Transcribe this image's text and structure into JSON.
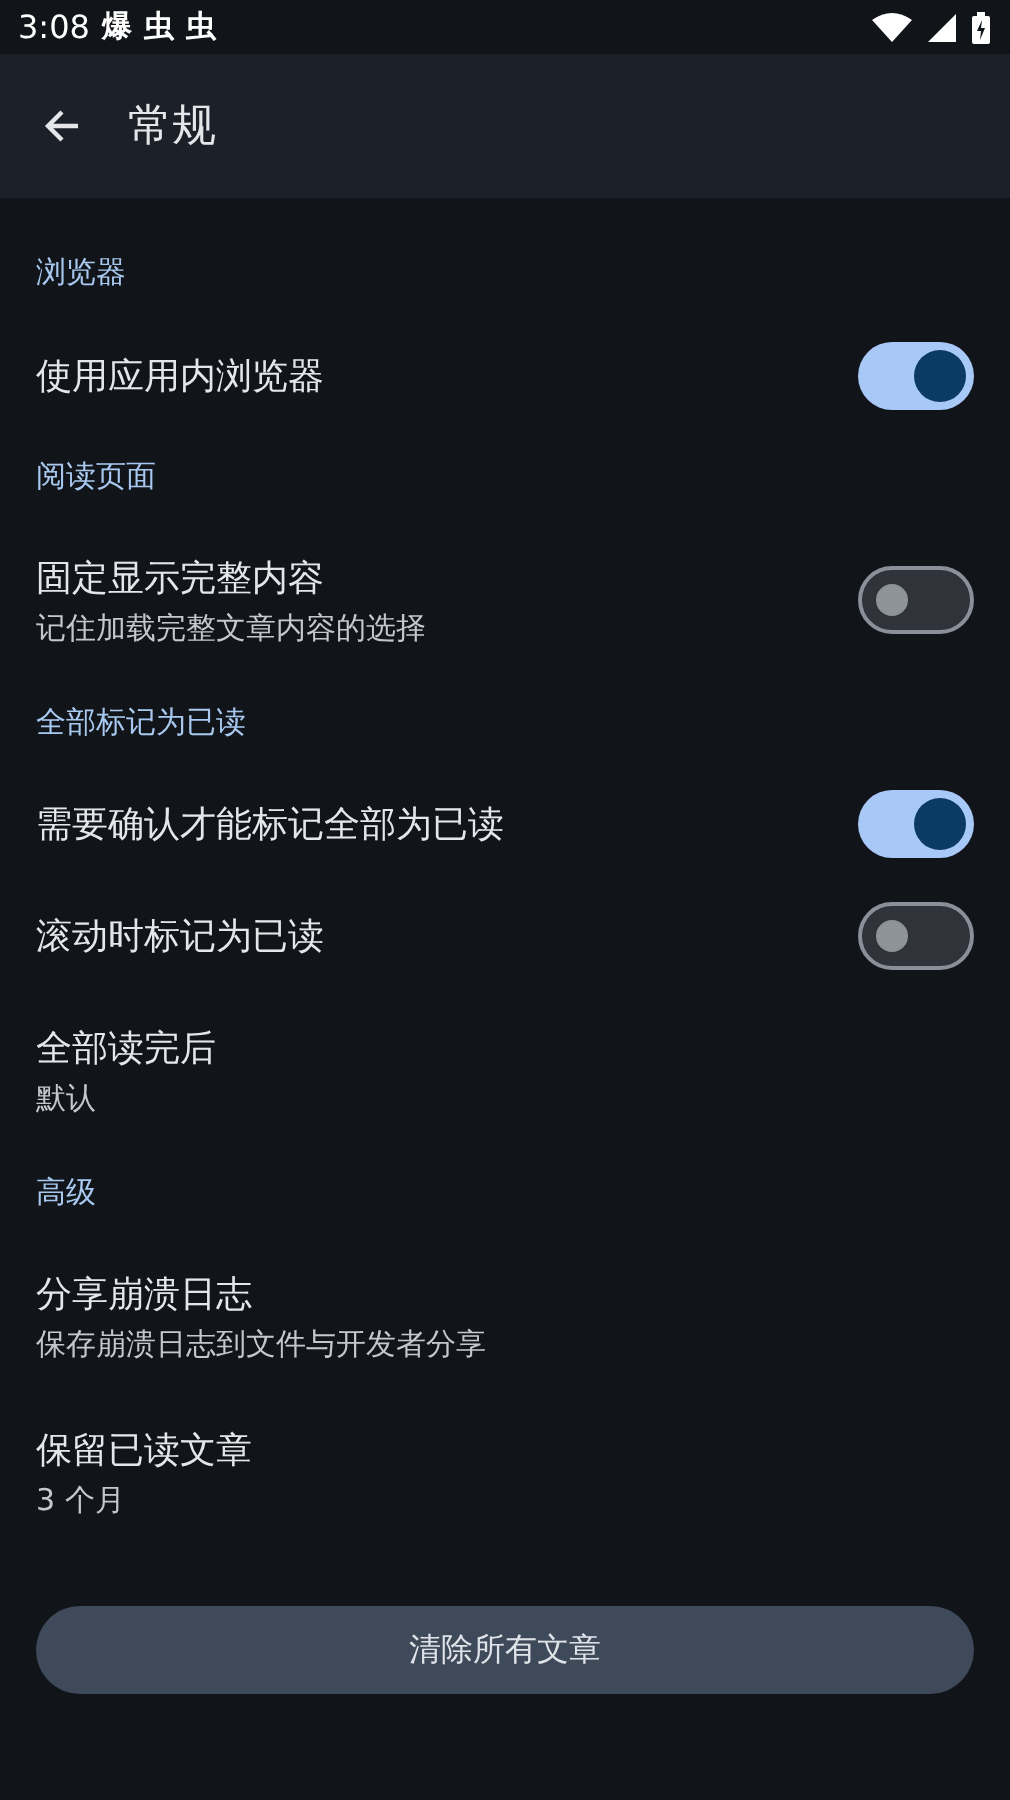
{
  "status_bar": {
    "time": "3:08",
    "notification_icons": [
      "爆",
      "虫",
      "虫"
    ]
  },
  "header": {
    "title": "常规"
  },
  "sections": [
    {
      "title": "浏览器",
      "items": [
        {
          "kind": "switch",
          "label": "使用应用内浏览器",
          "on": true
        }
      ]
    },
    {
      "title": "阅读页面",
      "items": [
        {
          "kind": "switch",
          "label": "固定显示完整内容",
          "summary": "记住加载完整文章内容的选择",
          "on": false
        }
      ]
    },
    {
      "title": "全部标记为已读",
      "items": [
        {
          "kind": "switch",
          "label": "需要确认才能标记全部为已读",
          "on": true
        },
        {
          "kind": "switch",
          "label": "滚动时标记为已读",
          "on": false
        },
        {
          "kind": "value",
          "label": "全部读完后",
          "summary": "默认"
        }
      ]
    },
    {
      "title": "高级",
      "items": [
        {
          "kind": "value",
          "label": "分享崩溃日志",
          "summary": "保存崩溃日志到文件与开发者分享"
        },
        {
          "kind": "value",
          "label": "保留已读文章",
          "summary": "3 个月"
        }
      ]
    }
  ],
  "clear_button": {
    "label": "清除所有文章"
  }
}
